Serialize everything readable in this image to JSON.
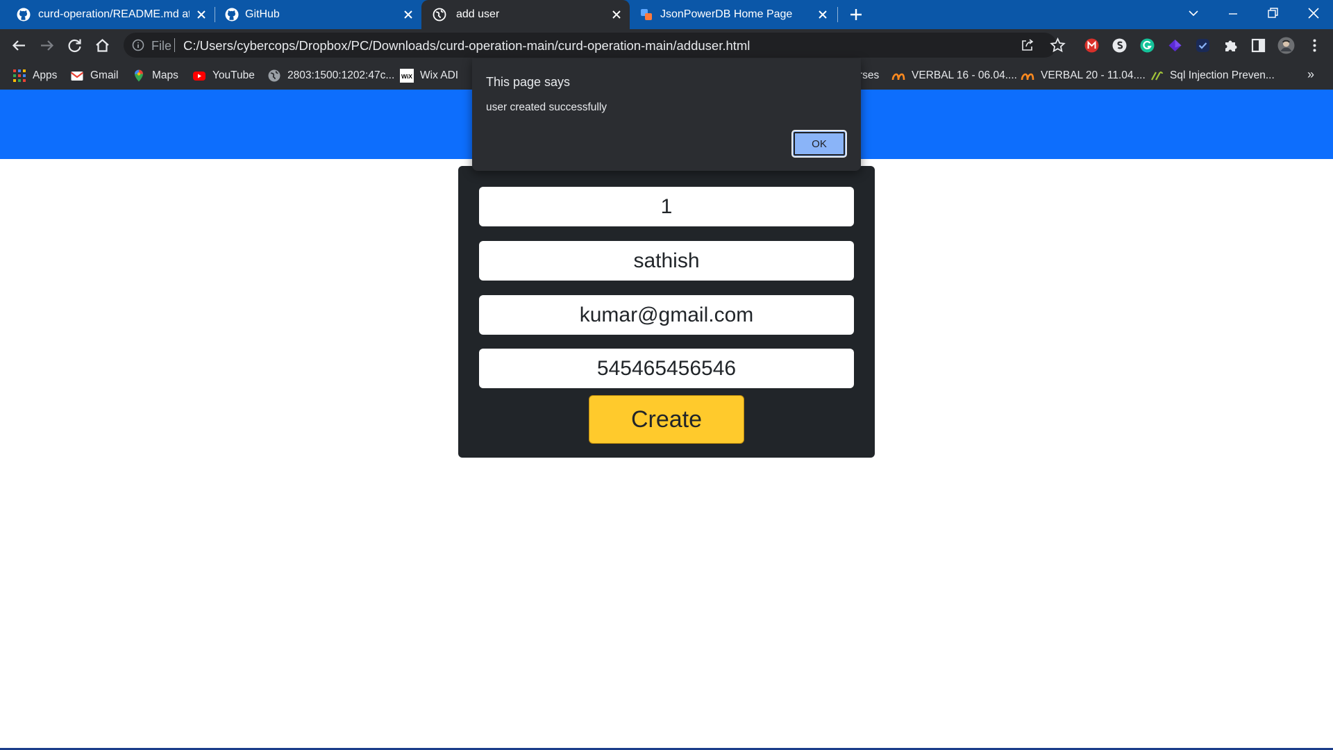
{
  "browser": {
    "tabs": [
      {
        "title": "curd-operation/README.md at m",
        "icon": "github-icon"
      },
      {
        "title": "GitHub",
        "icon": "github-icon"
      },
      {
        "title": "add user",
        "icon": "globe-icon",
        "active": true
      },
      {
        "title": "JsonPowerDB Home Page",
        "icon": "jsonpowerdb-icon"
      }
    ],
    "omnibox": {
      "scheme_label": "File",
      "url": "C:/Users/cybercops/Dropbox/PC/Downloads/curd-operation-main/curd-operation-main/adduser.html"
    },
    "bookmarks": [
      {
        "label": "Apps",
        "icon": "apps-grid-icon"
      },
      {
        "label": "Gmail",
        "icon": "gmail-icon"
      },
      {
        "label": "Maps",
        "icon": "maps-pin-icon"
      },
      {
        "label": "YouTube",
        "icon": "youtube-icon"
      },
      {
        "label": "2803:1500:1202:47c...",
        "icon": "globe-icon"
      },
      {
        "label": "Wix ADI",
        "icon": "wix-icon"
      },
      {
        "label": "rses",
        "icon": ""
      },
      {
        "label": "VERBAL 16 - 06.04....",
        "icon": "bookmark-logo-icon"
      },
      {
        "label": "VERBAL 20 - 11.04....",
        "icon": "bookmark-logo-icon"
      },
      {
        "label": "Sql Injection Preven...",
        "icon": "bookmark-logo-icon"
      }
    ],
    "more_bookmarks_label": "»"
  },
  "alert": {
    "title": "This page says",
    "message": "user created successfully",
    "ok_label": "OK"
  },
  "form": {
    "id_value": "1",
    "name_value": "sathish",
    "email_value": "kumar@gmail.com",
    "phone_value": "545465456546",
    "create_label": "Create"
  },
  "colors": {
    "tab_strip": "#0b57a8",
    "toolbar": "#2b2d31",
    "page_header": "#0d6efd",
    "form_card": "#212529",
    "create_button": "#ffca2c",
    "ok_button": "#8ab4f8"
  }
}
